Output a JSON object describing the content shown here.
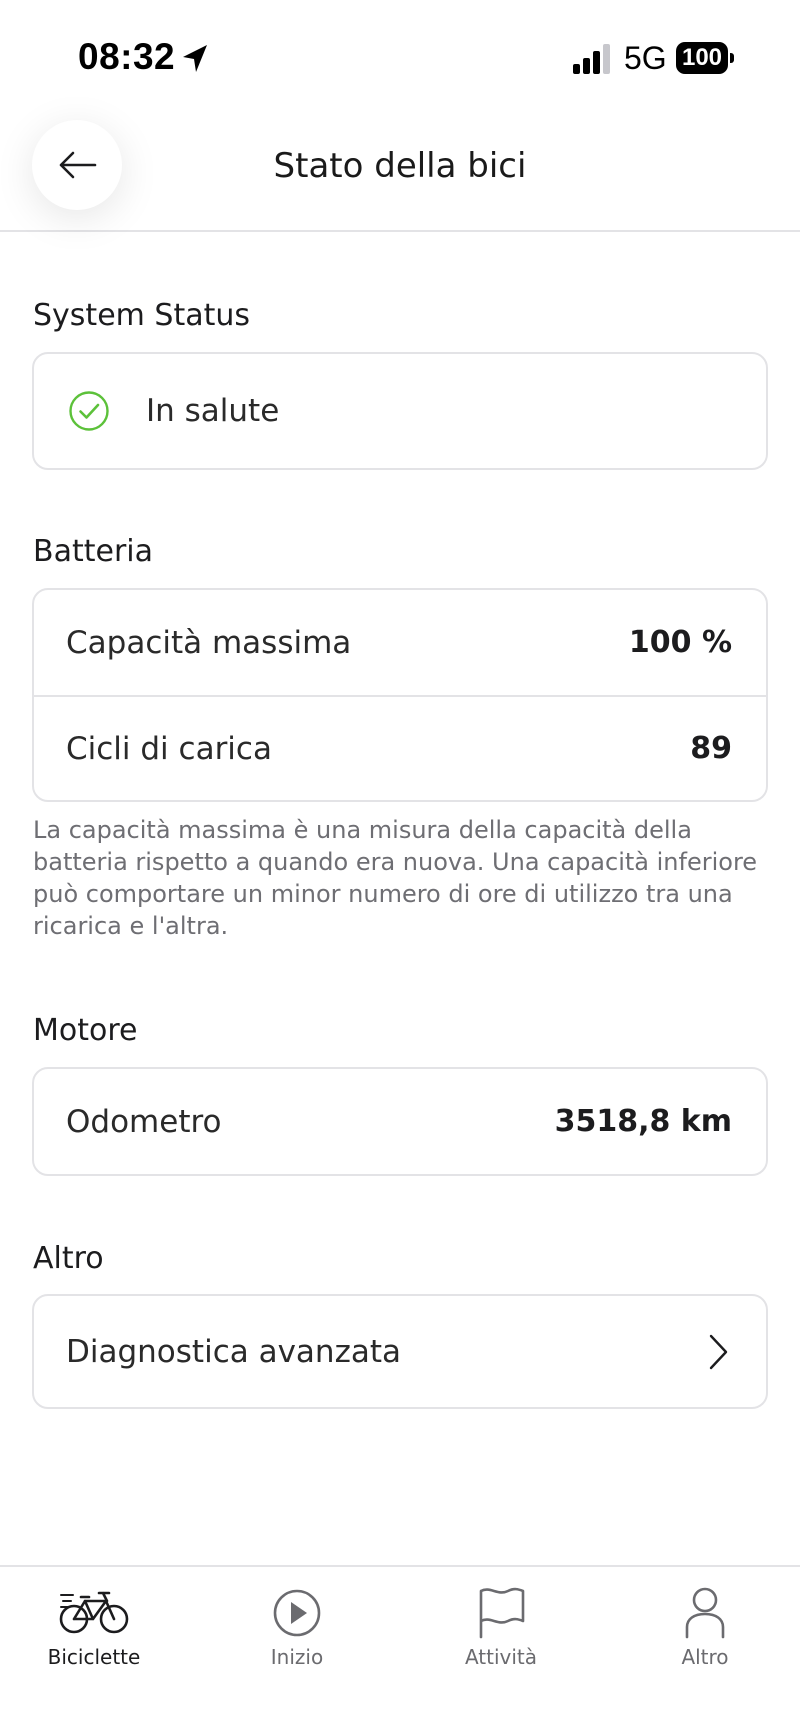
{
  "status_bar": {
    "time": "08:32",
    "network": "5G",
    "battery": "100",
    "icons": [
      "location-arrow-icon",
      "signal-icon",
      "battery-icon"
    ]
  },
  "header": {
    "title": "Stato della bici",
    "back_icon": "arrow-left-icon"
  },
  "system_status": {
    "title": "System Status",
    "status_text": "In salute",
    "status_icon": "check-circle-icon",
    "status_color": "#5cc13a"
  },
  "battery": {
    "title": "Batteria",
    "rows": [
      {
        "label": "Capacità massima",
        "value": "100 %"
      },
      {
        "label": "Cicli di carica",
        "value": "89"
      }
    ],
    "note": "La capacità massima è una misura della capacità della batteria rispetto a quando era nuova. Una capacità inferiore può comportare un minor numero di ore di utilizzo tra una ricarica e l'altra."
  },
  "motor": {
    "title": "Motore",
    "rows": [
      {
        "label": "Odometro",
        "value": "3518,8 km"
      }
    ]
  },
  "other": {
    "title": "Altro",
    "rows": [
      {
        "label": "Diagnostica avanzata",
        "icon": "chevron-right-icon"
      }
    ]
  },
  "tab_bar": {
    "tabs": [
      {
        "label": "Biciclette",
        "icon": "bicycle-icon",
        "active": true
      },
      {
        "label": "Inizio",
        "icon": "play-circle-icon",
        "active": false
      },
      {
        "label": "Attività",
        "icon": "flag-icon",
        "active": false
      },
      {
        "label": "Altro",
        "icon": "person-icon",
        "active": false
      }
    ]
  }
}
